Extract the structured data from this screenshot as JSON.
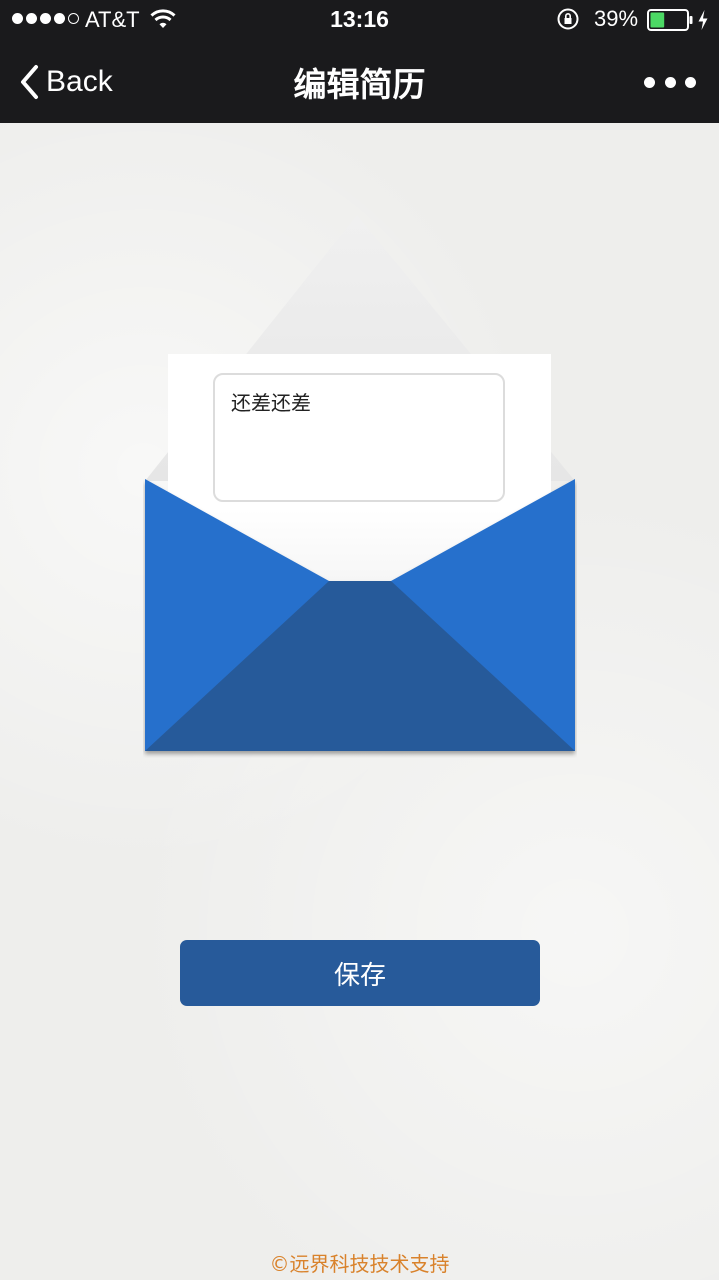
{
  "status_bar": {
    "carrier": "AT&T",
    "time": "13:16",
    "battery_percent": "39%",
    "battery_level": 0.39,
    "signal_bars": 4,
    "signal_total": 5
  },
  "nav": {
    "back_label": "Back",
    "title": "编辑简历"
  },
  "message": {
    "value": "还差还差"
  },
  "actions": {
    "save_label": "保存"
  },
  "footer": {
    "text": "©远界科技技术支持"
  },
  "colors": {
    "nav_bg": "#1a1a1c",
    "envelope_blue": "#2870cc",
    "envelope_dark_blue": "#275a9a",
    "button_bg": "#275a9a",
    "footer_text": "#d9822b",
    "battery_green": "#4cd964"
  },
  "icons": {
    "wifi": "wifi-icon",
    "lock": "rotation-lock-icon",
    "battery": "battery-icon",
    "charging": "charging-bolt-icon",
    "back": "chevron-left-icon",
    "more": "more-dots-icon"
  }
}
